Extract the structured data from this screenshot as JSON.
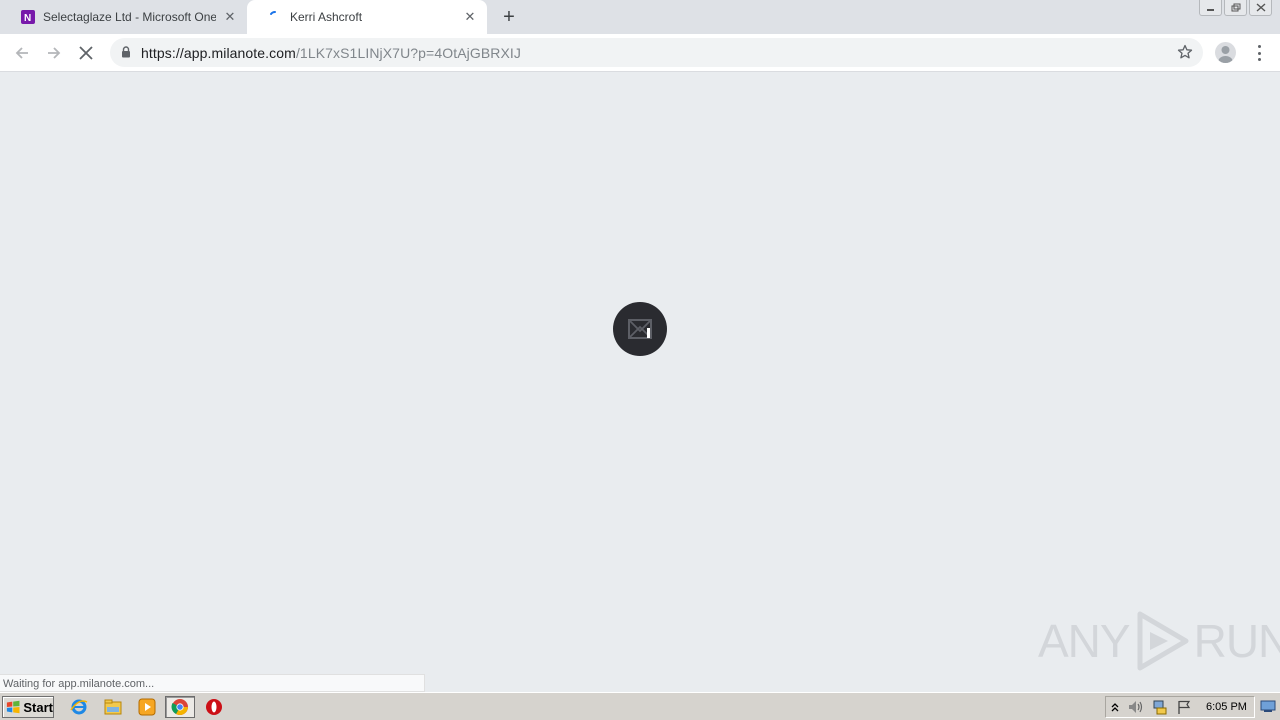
{
  "browser": {
    "tabs": [
      {
        "title": "Selectaglaze Ltd - Microsoft OneNote",
        "favicon": "onenote-icon",
        "active": false
      },
      {
        "title": "Kerri Ashcroft",
        "favicon": "loading-spinner-icon",
        "active": true
      }
    ],
    "address": {
      "url_host": "https://app.milanote.com",
      "url_path": "/1LK7xS1LINjX7U?p=4OtAjGBRXIJ"
    },
    "status_text": "Waiting for app.milanote.com..."
  },
  "page": {
    "loader_icon": "milanote-logo-icon",
    "watermark": {
      "left": "ANY",
      "right": "RUN"
    }
  },
  "taskbar": {
    "start_label": "Start",
    "pinned": [
      "internet-explorer-icon",
      "file-explorer-icon",
      "media-player-icon",
      "chrome-icon",
      "opera-icon"
    ],
    "clock": "6:05 PM"
  },
  "colors": {
    "page_bg": "#e9ecef",
    "tabstrip_bg": "#dee1e6",
    "loader_bg": "#2a2b30",
    "taskbar_bg": "#d6d3ce"
  }
}
